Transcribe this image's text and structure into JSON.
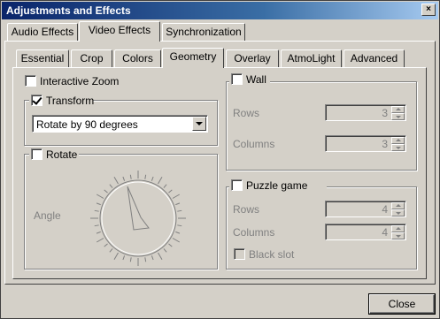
{
  "window": {
    "title": "Adjustments and Effects",
    "close_glyph": "×"
  },
  "top_tabs": [
    {
      "label": "Audio Effects",
      "selected": false
    },
    {
      "label": "Video Effects",
      "selected": true
    },
    {
      "label": "Synchronization",
      "selected": false
    }
  ],
  "sub_tabs": [
    {
      "label": "Essential",
      "selected": false
    },
    {
      "label": "Crop",
      "selected": false
    },
    {
      "label": "Colors",
      "selected": false
    },
    {
      "label": "Geometry",
      "selected": true
    },
    {
      "label": "Overlay",
      "selected": false
    },
    {
      "label": "AtmoLight",
      "selected": false
    },
    {
      "label": "Advanced",
      "selected": false
    }
  ],
  "geometry": {
    "interactive_zoom": {
      "label": "Interactive Zoom",
      "checked": false
    },
    "transform": {
      "label": "Transform",
      "checked": true,
      "selected_option": "Rotate by 90 degrees"
    },
    "rotate": {
      "label": "Rotate",
      "checked": false,
      "angle_label": "Angle"
    },
    "wall": {
      "label": "Wall",
      "checked": false,
      "rows_label": "Rows",
      "rows_value": "3",
      "columns_label": "Columns",
      "columns_value": "3"
    },
    "puzzle": {
      "label": "Puzzle game",
      "checked": false,
      "rows_label": "Rows",
      "rows_value": "4",
      "columns_label": "Columns",
      "columns_value": "4",
      "black_slot_label": "Black slot",
      "black_slot_checked": false
    }
  },
  "footer": {
    "close_label": "Close"
  }
}
